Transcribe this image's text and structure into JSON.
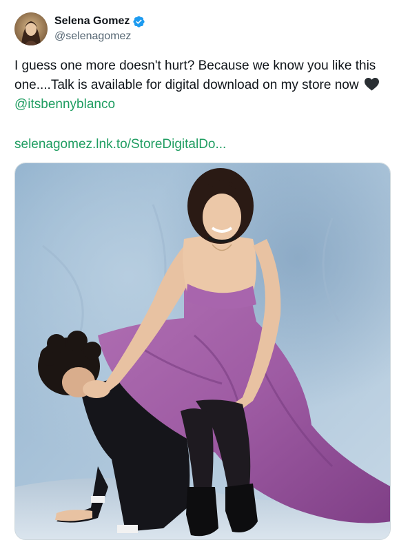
{
  "author": {
    "name": "Selena Gomez",
    "handle": "@selenagomez",
    "verified": true
  },
  "tweet": {
    "text_before": "I guess one more doesn't hurt? Because we know you like this one....Talk is available for digital download on my store now ",
    "emoji": "black-heart-icon",
    "mention": "@itsbennyblanco",
    "link": "selenagomez.lnk.to/StoreDigitalDo..."
  },
  "icons": {
    "verified": "verified-badge-icon",
    "heart": "black-heart-icon"
  },
  "colors": {
    "link": "#1f9d61",
    "verified": "#1d9bf0",
    "handle": "#536471",
    "text": "#0f1419"
  }
}
